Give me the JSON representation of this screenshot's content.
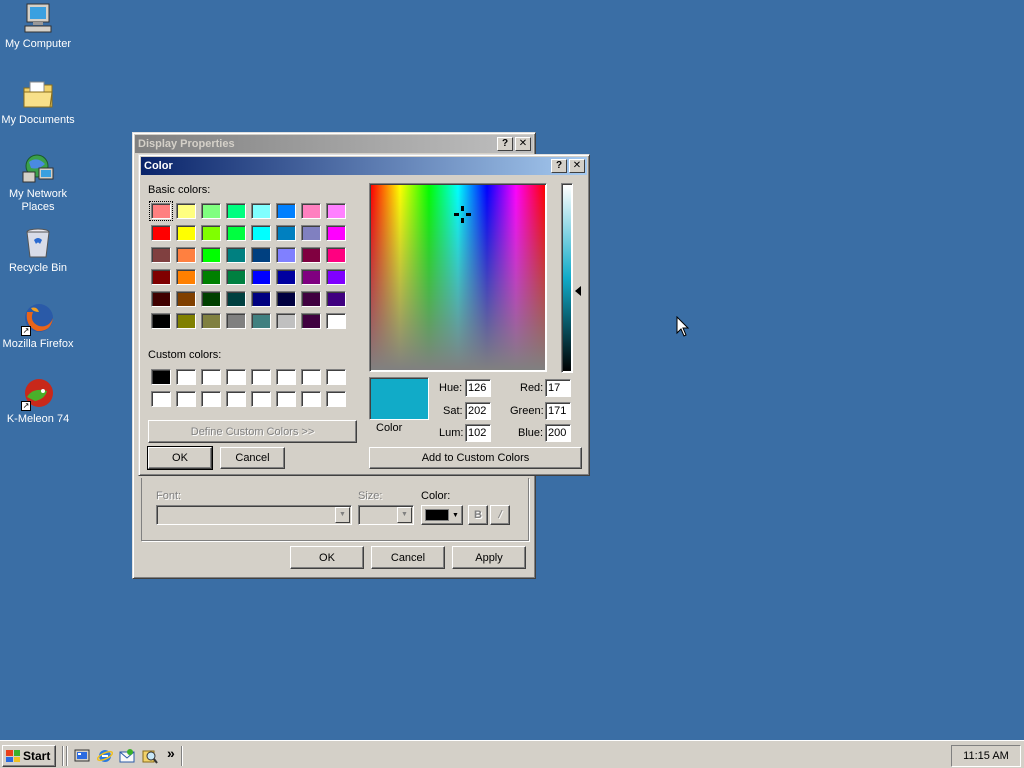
{
  "desktop": {
    "icons": [
      {
        "label": "My Computer",
        "icon": "computer-icon"
      },
      {
        "label": "My Documents",
        "icon": "folder-icon"
      },
      {
        "label": "My Network Places",
        "icon": "network-icon"
      },
      {
        "label": "Recycle Bin",
        "icon": "recycle-bin-icon"
      },
      {
        "label": "Mozilla Firefox",
        "icon": "firefox-icon"
      },
      {
        "label": "K-Meleon 74",
        "icon": "kmeleon-icon"
      }
    ]
  },
  "display_properties": {
    "title": "Display Properties",
    "font_label": "Font:",
    "size_label": "Size:",
    "color_label": "Color:",
    "bold_label": "B",
    "italic_label": "/",
    "ok_label": "OK",
    "cancel_label": "Cancel",
    "apply_label": "Apply"
  },
  "color_dialog": {
    "title": "Color",
    "help_label": "?",
    "close_label": "✕",
    "basic_colors_label": "Basic colors:",
    "custom_colors_label": "Custom colors:",
    "define_custom_label": "Define Custom Colors >>",
    "ok_label": "OK",
    "cancel_label": "Cancel",
    "preview_label": "Color",
    "add_custom_label": "Add to Custom Colors",
    "hue_label": "Hue:",
    "sat_label": "Sat:",
    "lum_label": "Lum:",
    "red_label": "Red:",
    "green_label": "Green:",
    "blue_label": "Blue:",
    "hue": "126",
    "sat": "202",
    "lum": "102",
    "red": "17",
    "green": "171",
    "blue": "200",
    "current_color": "#11abc8",
    "basic_colors": [
      [
        "#ff8080",
        "#ffff80",
        "#80ff80",
        "#00ff80",
        "#80ffff",
        "#0080ff",
        "#ff80c0",
        "#ff80ff"
      ],
      [
        "#ff0000",
        "#ffff00",
        "#80ff00",
        "#00ff40",
        "#00ffff",
        "#0080c0",
        "#8080c0",
        "#ff00ff"
      ],
      [
        "#804040",
        "#ff8040",
        "#00ff00",
        "#008080",
        "#004080",
        "#8080ff",
        "#800040",
        "#ff0080"
      ],
      [
        "#800000",
        "#ff8000",
        "#008000",
        "#008040",
        "#0000ff",
        "#0000a0",
        "#800080",
        "#8000ff"
      ],
      [
        "#400000",
        "#804000",
        "#004000",
        "#004040",
        "#000080",
        "#000040",
        "#400040",
        "#400080"
      ],
      [
        "#000000",
        "#808000",
        "#808040",
        "#808080",
        "#408080",
        "#c0c0c0",
        "#400040",
        "#ffffff"
      ]
    ],
    "custom_colors": [
      [
        "#000000",
        "#ffffff",
        "#ffffff",
        "#ffffff",
        "#ffffff",
        "#ffffff",
        "#ffffff",
        "#ffffff"
      ],
      [
        "#ffffff",
        "#ffffff",
        "#ffffff",
        "#ffffff",
        "#ffffff",
        "#ffffff",
        "#ffffff",
        "#ffffff"
      ]
    ]
  },
  "taskbar": {
    "start_label": "Start",
    "clock": "11:15 AM",
    "chevron": "»",
    "quick_launch": [
      "show-desktop-icon",
      "internet-explorer-icon",
      "outlook-icon",
      "search-icon"
    ]
  }
}
